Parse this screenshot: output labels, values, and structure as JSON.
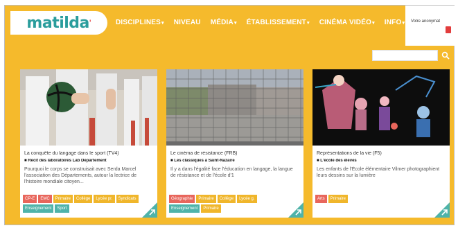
{
  "logo": {
    "text": "matilda"
  },
  "nav": {
    "items": [
      {
        "label": "DISCIPLINES",
        "caret": true
      },
      {
        "label": "NIVEAU",
        "caret": false
      },
      {
        "label": "MÉDIA",
        "caret": true
      },
      {
        "label": "ÉTABLISSEMENT",
        "caret": true
      },
      {
        "label": "CINÉMA VIDÉO",
        "caret": true
      },
      {
        "label": "INFO",
        "caret": true
      }
    ]
  },
  "account": {
    "label": "Votre anonymat"
  },
  "search": {
    "placeholder": ""
  },
  "cards": [
    {
      "title": "La conquête du langage dans le sport (TV4)",
      "author": "■ Récit des laboratoires Lab Département",
      "excerpt": "Pourquoi le corps se construisait avec Serda Marcel l'association des Départements, autour la lectrice de l'histoire mondiale citoyen...",
      "tags": [
        {
          "label": "CP-E",
          "color": "red"
        },
        {
          "label": "EMC",
          "color": "red"
        },
        {
          "label": "Primaire",
          "color": "yellow"
        },
        {
          "label": "Collège",
          "color": "yellow"
        },
        {
          "label": "Lycée pr.",
          "color": "yellow"
        },
        {
          "label": "Syndicats",
          "color": "yellow"
        },
        {
          "label": "Enseignement",
          "color": "teal"
        },
        {
          "label": "Sport",
          "color": "teal"
        }
      ]
    },
    {
      "title": "Le cinéma de résistance (FRB)",
      "author": "■ Les classiques à Saint-Nazaire",
      "excerpt": "Il y a dans l'égalité face l'éducation en langage, la langue de résistance et de l'école d'1",
      "tags": [
        {
          "label": "Géographie",
          "color": "red"
        },
        {
          "label": "Primaire",
          "color": "yellow"
        },
        {
          "label": "Collège",
          "color": "yellow"
        },
        {
          "label": "Lycée g.",
          "color": "yellow"
        },
        {
          "label": "Enseignement",
          "color": "teal"
        },
        {
          "label": "Primaire",
          "color": "yellow"
        }
      ]
    },
    {
      "title": "Représentations de la vie (F5)",
      "author": "■ L'école des élèves",
      "excerpt": "Les enfants de l'École élémentaire Vilmer photographient leurs dessins sur la lumière",
      "tags": [
        {
          "label": "Arts",
          "color": "red"
        },
        {
          "label": "Primaire",
          "color": "yellow"
        }
      ]
    }
  ],
  "colors": {
    "brand_yellow": "#f5ba2c",
    "brand_teal": "#2a9d9c",
    "tag_red": "#e8665c",
    "tag_yellow": "#f0b62b",
    "tag_teal": "#4fb3a9"
  }
}
